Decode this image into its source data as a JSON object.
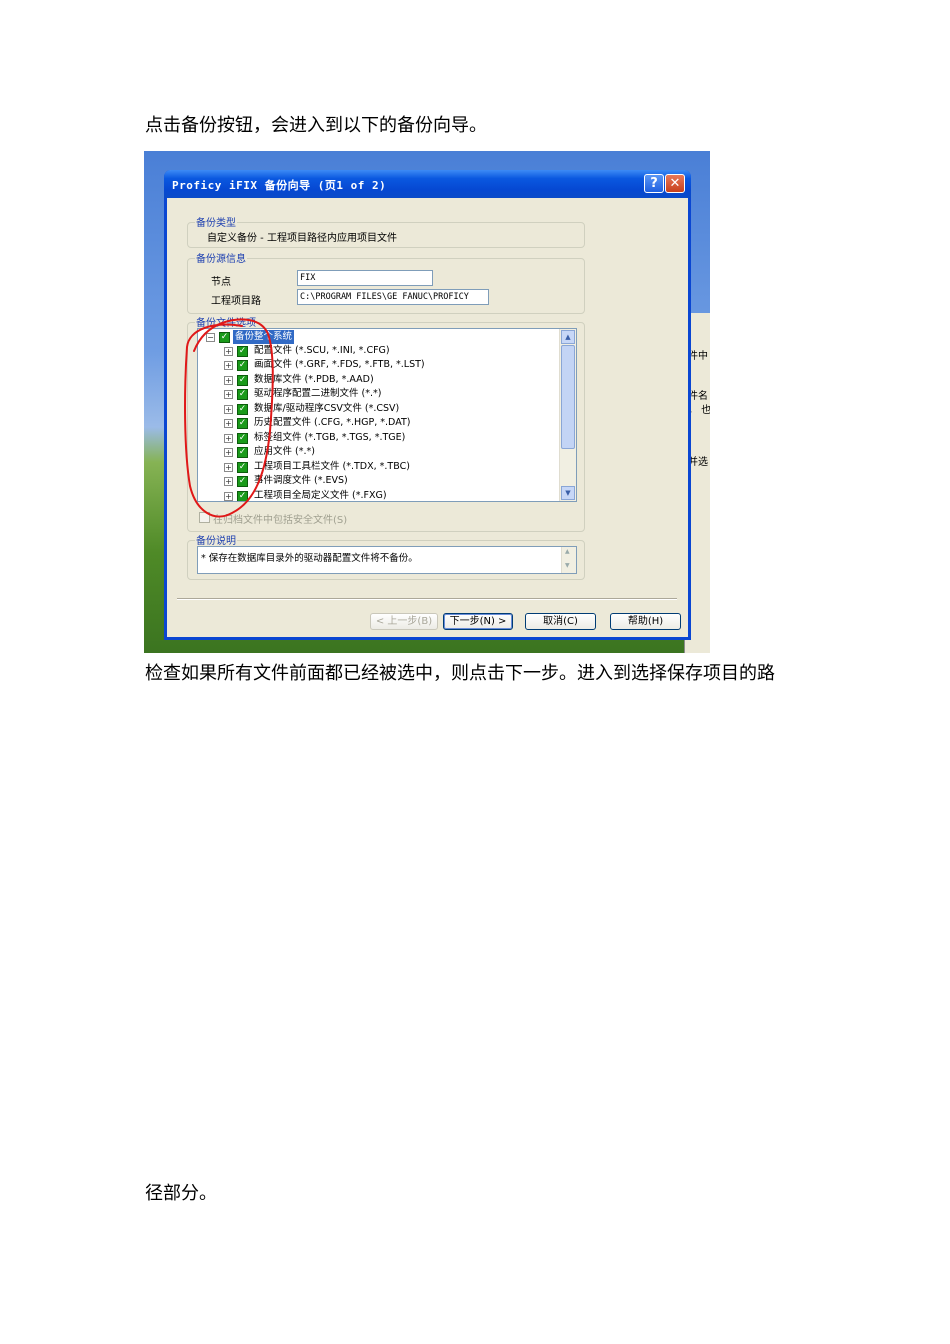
{
  "paragraphs": {
    "intro": "点击备份按钮，会进入到以下的备份向导。",
    "check": "检查如果所有文件前面都已经被选中，则点击下一步。进入到选择保存项目的路",
    "continuation": "径部分。"
  },
  "dialog": {
    "title": "Proficy iFIX 备份向导 (页1 of 2)",
    "help_glyph": "?",
    "close_glyph": "✕",
    "backup_type": {
      "label": "备份类型",
      "value": "自定义备份 - 工程项目路径内应用项目文件"
    },
    "source": {
      "label": "备份源信息",
      "node_label": "节点",
      "node_value": "FIX",
      "path_label": "工程项目路",
      "path_value": "C:\\PROGRAM FILES\\GE FANUC\\PROFICY"
    },
    "options": {
      "label": "备份文件选项",
      "root": "备份整个系统",
      "items": [
        "配置文件  (*.SCU, *.INI, *.CFG)",
        "画面文件  (*.GRF, *.FDS, *.FTB, *.LST)",
        "数据库文件  (*.PDB, *.AAD)",
        "驱动程序配置二进制文件  (*.*)",
        "数据库/驱动程序CSV文件  (*.CSV)",
        "历史配置文件  (.CFG, *.HGP, *.DAT)",
        "标签组文件  (*.TGB, *.TGS, *.TGE)",
        "应用文件  (*.*)",
        "工程项目工具栏文件 (*.TDX, *.TBC)",
        "事件调度文件  (*.EVS)",
        "工程项目全局定义文件 (*.FXG)"
      ],
      "security_option": "在归档文件中包括安全文件(S)"
    },
    "description": {
      "label": "备份说明",
      "text": "* 保存在数据库目录外的驱动器配置文件将不备份。"
    },
    "buttons": {
      "back": "< 上一步(B)",
      "next": "下一步(N) >",
      "cancel": "取消(C)",
      "help": "帮助(H)"
    },
    "background_window_fragments": [
      "件中",
      "件名",
      "， 也",
      "并选"
    ],
    "annotation_color": "#e01818"
  }
}
